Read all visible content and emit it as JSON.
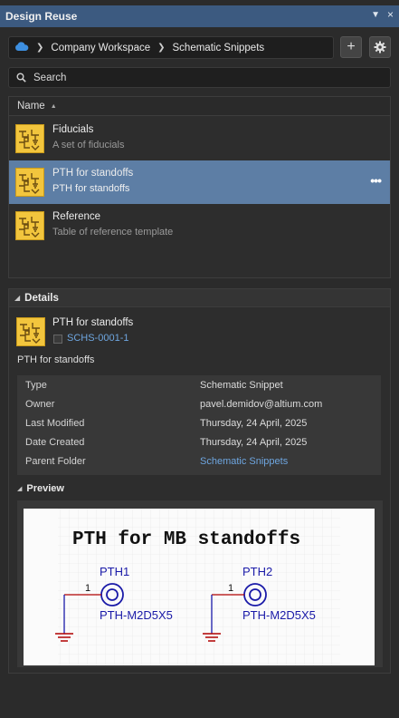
{
  "panel": {
    "title": "Design Reuse",
    "pin_icon": "▼",
    "close_icon": "×"
  },
  "path": {
    "cloud_icon": "cloud-icon",
    "crumbs": [
      "Company Workspace",
      "Schematic Snippets"
    ]
  },
  "toolbar": {
    "add_icon": "+",
    "settings_icon": "gear-icon"
  },
  "search": {
    "placeholder": "Search"
  },
  "list": {
    "column_header": "Name",
    "items": [
      {
        "title": "Fiducials",
        "description": "A set of fiducials",
        "selected": false
      },
      {
        "title": "PTH for standoffs",
        "description": "PTH for standoffs",
        "selected": true
      },
      {
        "title": "Reference",
        "description": "Table of reference template",
        "selected": false
      }
    ],
    "more_icon": "•••"
  },
  "details": {
    "header": "Details",
    "name": "PTH for standoffs",
    "item_id": "SCHS-0001-1",
    "description": "PTH for standoffs",
    "properties": [
      {
        "key": "Type",
        "value": "Schematic Snippet"
      },
      {
        "key": "Owner",
        "value": "pavel.demidov@altium.com"
      },
      {
        "key": "Last Modified",
        "value": "Thursday, 24 April, 2025"
      },
      {
        "key": "Date Created",
        "value": "Thursday, 24 April, 2025"
      },
      {
        "key": "Parent Folder",
        "value": "Schematic Snippets"
      }
    ],
    "preview_header": "Preview",
    "preview": {
      "title": "PTH for MB standoffs",
      "parts": [
        {
          "designator": "PTH1",
          "footprint": "PTH-M2D5X5",
          "pin": "1"
        },
        {
          "designator": "PTH2",
          "footprint": "PTH-M2D5X5",
          "pin": "1"
        }
      ]
    }
  },
  "colors": {
    "titlebar": "#3c5a80",
    "selection": "#5d7ea5",
    "link": "#6ea6e0",
    "icon_yellow": "#f2c53d",
    "schematic_blue": "#1a1aa8",
    "schematic_red": "#b00000"
  }
}
